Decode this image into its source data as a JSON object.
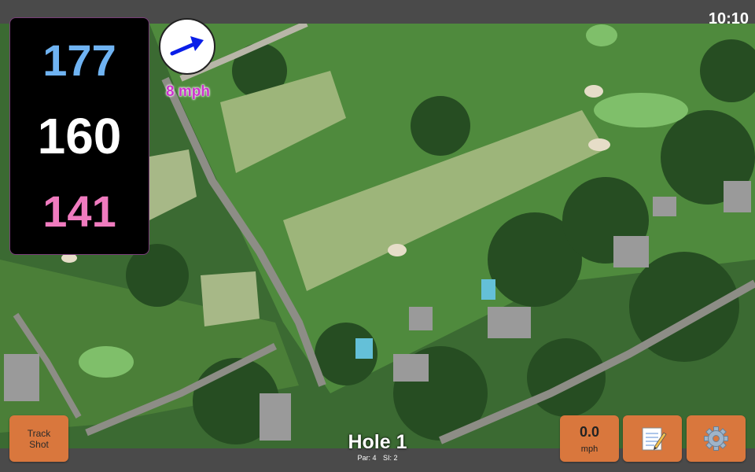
{
  "status": {
    "time": "10:10"
  },
  "distances": {
    "back": "177",
    "center": "160",
    "front": "141"
  },
  "wind": {
    "label": "8 mph",
    "icon": "wind-direction-arrow-icon"
  },
  "hole": {
    "title": "Hole 1",
    "par": "Par: 4",
    "si": "SI: 2"
  },
  "buttons": {
    "track_shot": "Track\nShot",
    "wind_speed_value": "0.0",
    "wind_speed_unit": "mph",
    "notes_icon": "notepad-icon",
    "settings_icon": "gear-icon"
  },
  "colors": {
    "back_distance": "#6fb3f2",
    "center_distance": "#ffffff",
    "front_distance": "#f07bbf",
    "button": "#d9773d",
    "wind_label": "#cc33cc"
  }
}
